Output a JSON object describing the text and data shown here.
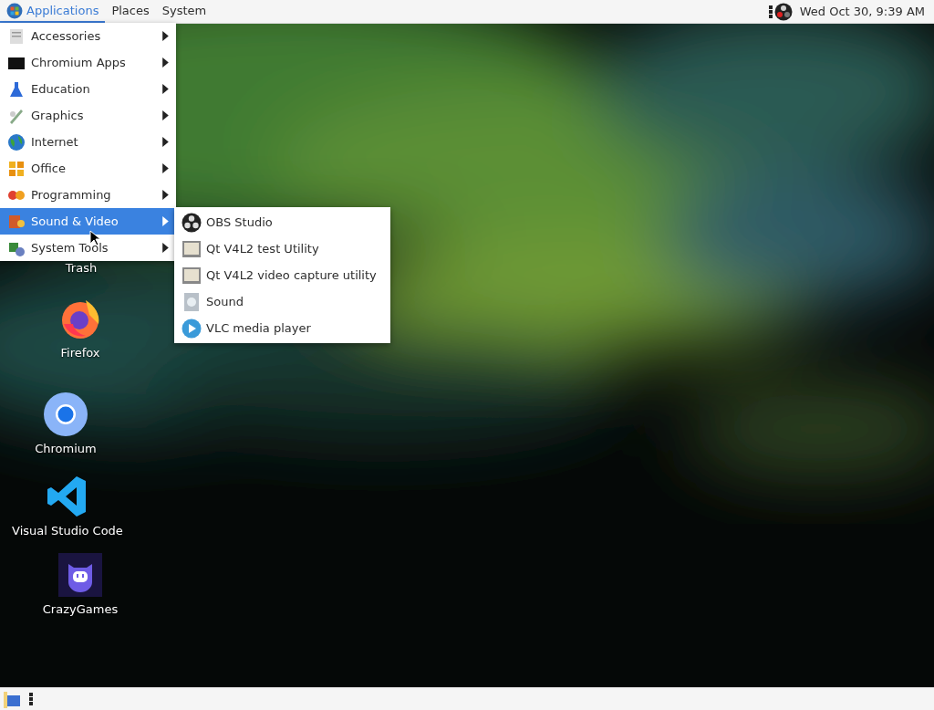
{
  "top_panel": {
    "menus": [
      {
        "label": "Applications",
        "selected": true
      },
      {
        "label": "Places",
        "selected": false
      },
      {
        "label": "System",
        "selected": false
      }
    ],
    "clock": "Wed Oct 30,  9:39 AM"
  },
  "applications_menu": {
    "items": [
      {
        "label": "Accessories",
        "selected": false
      },
      {
        "label": "Chromium Apps",
        "selected": false
      },
      {
        "label": "Education",
        "selected": false
      },
      {
        "label": "Graphics",
        "selected": false
      },
      {
        "label": "Internet",
        "selected": false
      },
      {
        "label": "Office",
        "selected": false
      },
      {
        "label": "Programming",
        "selected": false
      },
      {
        "label": "Sound & Video",
        "selected": true
      },
      {
        "label": "System Tools",
        "selected": false
      }
    ]
  },
  "submenu": {
    "items": [
      {
        "label": "OBS Studio"
      },
      {
        "label": "Qt V4L2 test Utility"
      },
      {
        "label": "Qt V4L2 video capture utility"
      },
      {
        "label": "Sound"
      },
      {
        "label": "VLC media player"
      }
    ]
  },
  "desktop_icons": [
    {
      "label": "Trash"
    },
    {
      "label": "Firefox"
    },
    {
      "label": "Chromium"
    },
    {
      "label": "Visual Studio Code"
    },
    {
      "label": "CrazyGames"
    }
  ]
}
